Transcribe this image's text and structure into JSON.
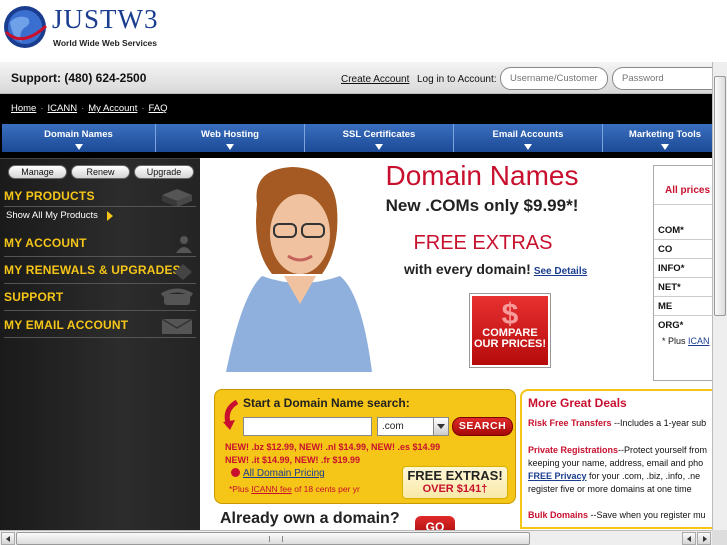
{
  "header": {
    "logo_name": "JUSTW3",
    "logo_tagline": "World Wide Web Services"
  },
  "support_bar": {
    "support_text": "Support: (480) 624-2500",
    "create_account": "Create Account",
    "login_label": "Log in to Account:",
    "username_placeholder": "Username/Customer #",
    "password_placeholder": "Password"
  },
  "top_links": [
    "Home",
    "ICANN",
    "My Account",
    "FAQ"
  ],
  "nav_tabs": [
    "Domain Names",
    "Web Hosting",
    "SSL Certificates",
    "Email Accounts",
    "Marketing Tools"
  ],
  "sidebar": {
    "buttons": [
      "Manage",
      "Renew",
      "Upgrade"
    ],
    "sections": [
      "MY PRODUCTS",
      "MY ACCOUNT",
      "MY RENEWALS & UPGRADES",
      "SUPPORT",
      "MY EMAIL ACCOUNT"
    ],
    "show_all": "Show All My Products"
  },
  "hero": {
    "title": "Domain Names",
    "subtitle": "New .COMs only $9.99*!",
    "free_extras": "FREE EXTRAS",
    "every_domain": "with every domain!",
    "see_details": "See Details",
    "compare_button": "COMPARE OUR PRICES!",
    "compare_symbol": "$"
  },
  "price_panel": {
    "heading": "All prices",
    "tlds": [
      "COM*",
      "CO",
      "INFO*",
      "NET*",
      "ME",
      "ORG*"
    ],
    "note_prefix": "* Plus",
    "note_link": "ICAN"
  },
  "search": {
    "heading": "Start a Domain Name search:",
    "domain_value": "",
    "tld_selected": ".com",
    "button": "SEARCH",
    "promo_line_1": "NEW! .bz $12.99, NEW! .nl $14.99, NEW! .es $14.99",
    "promo_line_2": "NEW! .it $14.99, NEW! .fr $19.99",
    "all_pricing": "All Domain Pricing",
    "icann_prefix": "*Plus",
    "icann_link": "ICANN fee",
    "icann_suffix": "of 18 cents per yr",
    "free_badge_1": "FREE EXTRAS!",
    "free_badge_2": "OVER $141†"
  },
  "already_own": {
    "text": "Already own a domain?",
    "go": "GO"
  },
  "deals": {
    "heading": "More Great Deals",
    "items": [
      {
        "title": "Risk Free Transfers",
        "text": " --Includes a 1-year sub"
      },
      {
        "title": "Private Registrations",
        "text": "--Protect yourself from"
      },
      {
        "title": "",
        "text": "keeping your name, address, email and pho"
      },
      {
        "title": "FREE Privacy",
        "text": " for your .com, .biz, .info, .ne"
      },
      {
        "title": "",
        "text": "register five or more domains at one time"
      },
      {
        "title": "Bulk Domains",
        "text": " --Save when you register mu"
      }
    ]
  },
  "colors": {
    "brand_blue": "#1a3d8f",
    "accent_red": "#c8102e",
    "accent_yellow": "#f5c518"
  }
}
